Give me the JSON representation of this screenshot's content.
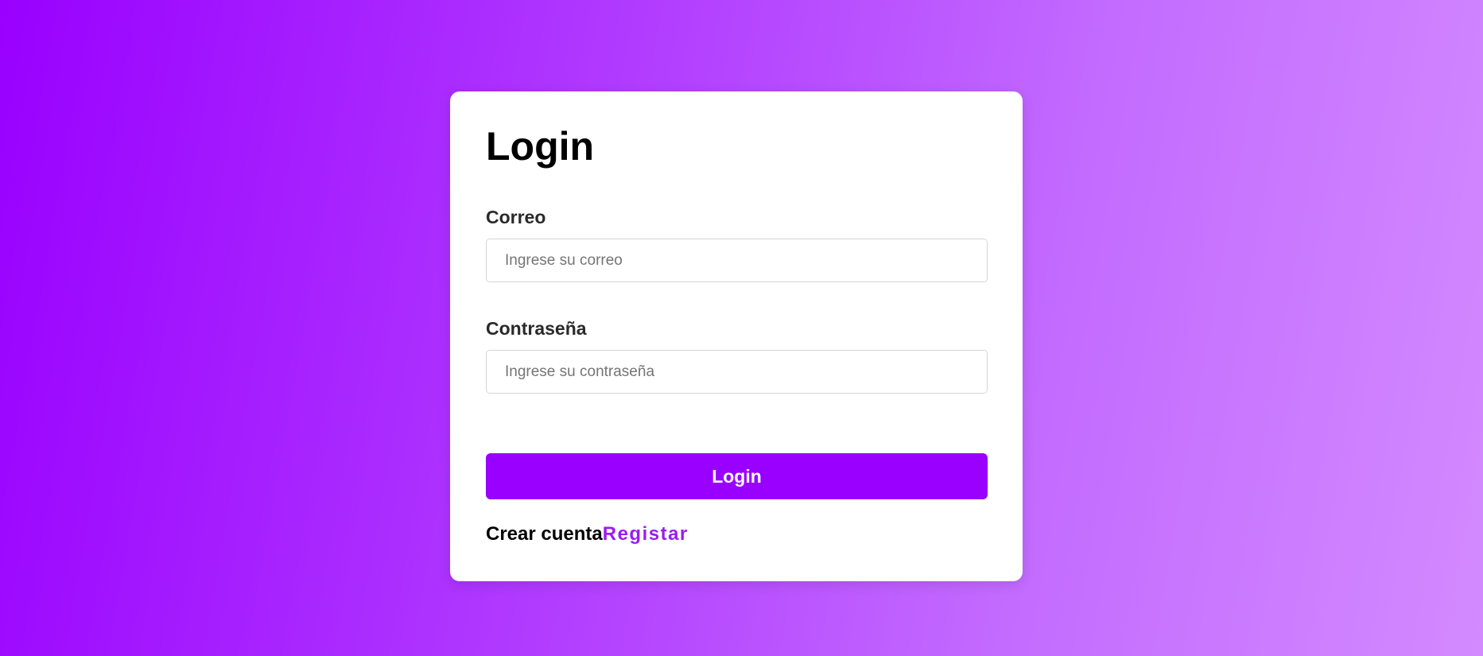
{
  "login": {
    "title": "Login",
    "email": {
      "label": "Correo",
      "value": "",
      "placeholder": "Ingrese su correo"
    },
    "password": {
      "label": "Contraseña",
      "value": "",
      "placeholder": "Ingrese su contraseña"
    },
    "submit_label": "Login",
    "footer": {
      "prompt": "Crear cuenta",
      "link_label": "Registar"
    }
  },
  "colors": {
    "accent": "#9900ff",
    "link": "#9b1cf2",
    "card": "#ffffff"
  }
}
